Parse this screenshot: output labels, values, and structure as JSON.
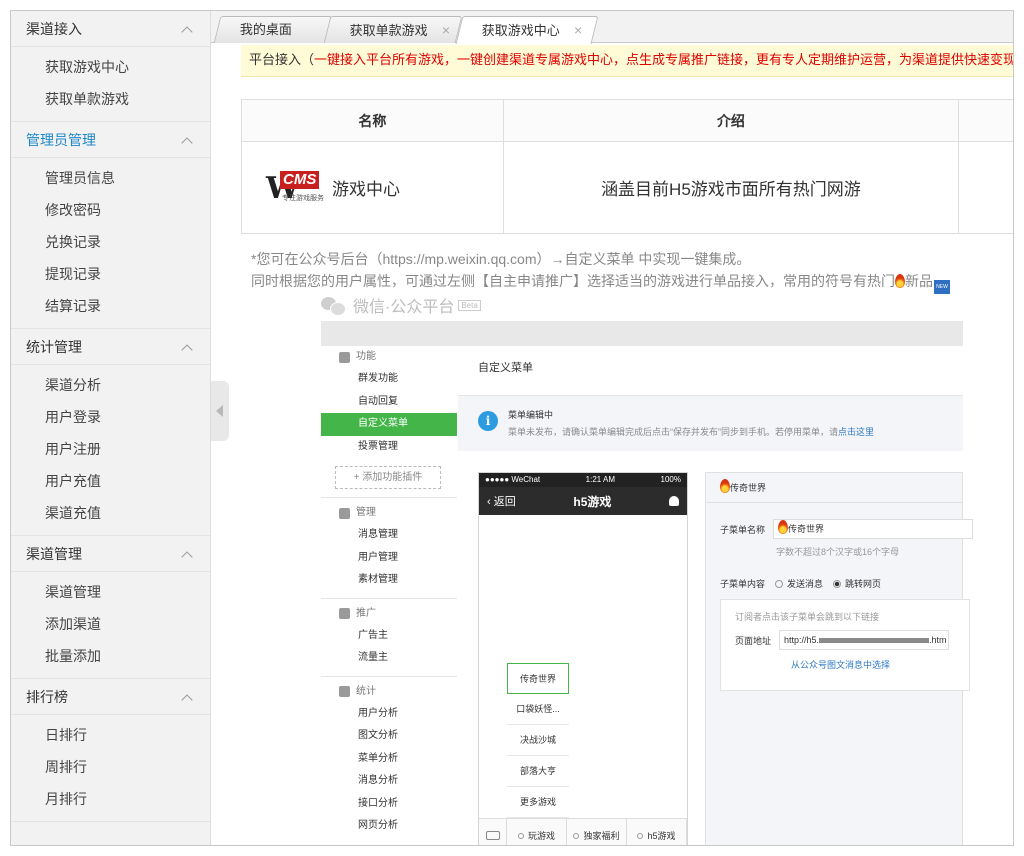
{
  "sidebar": {
    "groups": [
      {
        "title": "渠道接入",
        "active": false,
        "items": [
          "获取游戏中心",
          "获取单款游戏"
        ]
      },
      {
        "title": "管理员管理",
        "active": true,
        "items": [
          "管理员信息",
          "修改密码",
          "兑换记录",
          "提现记录",
          "结算记录"
        ]
      },
      {
        "title": "统计管理",
        "active": false,
        "items": [
          "渠道分析",
          "用户登录",
          "用户注册",
          "用户充值",
          "渠道充值"
        ]
      },
      {
        "title": "渠道管理",
        "active": false,
        "items": [
          "渠道管理",
          "添加渠道",
          "批量添加"
        ]
      },
      {
        "title": "排行榜",
        "active": false,
        "items": [
          "日排行",
          "周排行",
          "月排行"
        ]
      }
    ]
  },
  "tabs": [
    {
      "label": "我的桌面",
      "closable": false
    },
    {
      "label": "获取单款游戏",
      "closable": true,
      "close": "×"
    },
    {
      "label": "获取游戏中心",
      "closable": true,
      "close": "×",
      "active": true
    }
  ],
  "notice": {
    "prefix": "平台接入（",
    "text": "一键接入平台所有游戏，一键创建渠道专属游戏中心，点生成专属推广链接，更有专人定期维护运营，为渠道提供快速变现",
    "suffix": "）"
  },
  "table": {
    "headers": [
      "名称",
      "介绍"
    ],
    "row": {
      "logo_w": "W",
      "logo_cms": "CMS",
      "logo_sub": "专注游戏服务",
      "name": "游戏中心",
      "intro": "涵盖目前H5游戏市面所有热门网游"
    }
  },
  "hint": {
    "line1": "*您可在公众号后台（https://mp.weixin.qq.com）→自定义菜单 中实现一键集成。",
    "line2": "同时根据您的用户属性，可通过左侧【自主申请推广】选择适当的游戏进行单品接入，常用的符号有热门",
    "line2_new": "新品",
    "new_badge": "NEW"
  },
  "wechat": {
    "brand": "微信·公众平台",
    "beta": "Beta",
    "nav": [
      {
        "section": "功能",
        "items": [
          "群发功能",
          "自动回复",
          "自定义菜单",
          "投票管理"
        ],
        "selected": "自定义菜单",
        "add": "+ 添加功能插件"
      },
      {
        "section": "管理",
        "items": [
          "消息管理",
          "用户管理",
          "素材管理"
        ]
      },
      {
        "section": "推广",
        "items": [
          "广告主",
          "流量主"
        ]
      },
      {
        "section": "统计",
        "items": [
          "用户分析",
          "图文分析",
          "菜单分析",
          "消息分析",
          "接口分析",
          "网页分析"
        ]
      }
    ],
    "page_title": "自定义菜单",
    "info": {
      "title": "菜单编辑中",
      "sub": "菜单未发布，请确认菜单编辑完成后点击“保存并发布”同步到手机。若停用菜单，请",
      "link": "点击这里"
    },
    "phone": {
      "carrier": "●●●●● WeChat",
      "time": "1:21 AM",
      "battery": "100%",
      "back": "返回",
      "title": "h5游戏",
      "submenu": [
        "传奇世界",
        "口袋妖怪...",
        "决战沙城",
        "部落大亨",
        "更多游戏"
      ],
      "menu": [
        "玩游戏",
        "独家福利",
        "h5游戏"
      ]
    },
    "editor": {
      "heading": "传奇世界",
      "name_label": "子菜单名称",
      "name_value": "传奇世界",
      "name_hint": "字数不超过8个汉字或16个字母",
      "content_label": "子菜单内容",
      "opt_send": "发送消息",
      "opt_jump": "跳转网页",
      "jump_hint": "订阅者点击该子菜单会跳到以下链接",
      "url_label": "页面地址",
      "url_prefix": "http://h5.",
      "url_suffix": ".htm",
      "pick_link": "从公众号图文消息中选择"
    }
  }
}
